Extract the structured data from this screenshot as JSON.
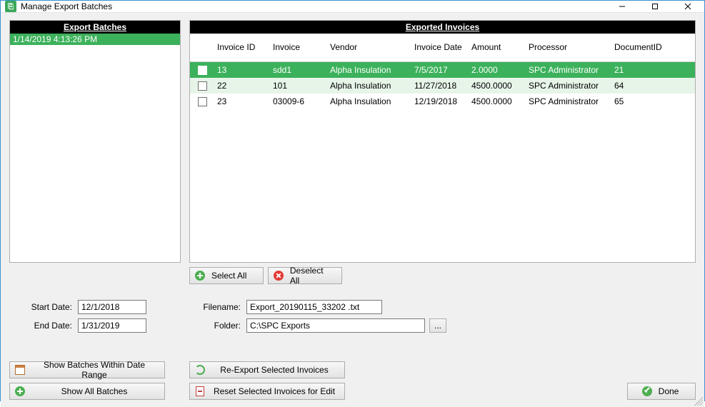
{
  "window": {
    "title": "Manage Export Batches"
  },
  "panels": {
    "batches_header": "Export Batches",
    "invoices_header": "Exported Invoices"
  },
  "batches": [
    {
      "label": "1/14/2019 4:13:26 PM"
    }
  ],
  "invoice_columns": {
    "col1": "Invoice ID",
    "col2": "Invoice",
    "col3": "Vendor",
    "col4": "Invoice Date",
    "col5": "Amount",
    "col6": "Processor",
    "col7": "DocumentID"
  },
  "invoices": [
    {
      "id": "13",
      "invoice": "sdd1",
      "vendor": "Alpha Insulation",
      "date": "7/5/2017",
      "amount": "2.0000",
      "processor": "SPC Administrator",
      "docid": "21"
    },
    {
      "id": "22",
      "invoice": "101",
      "vendor": "Alpha Insulation",
      "date": "11/27/2018",
      "amount": "4500.0000",
      "processor": "SPC Administrator",
      "docid": "64"
    },
    {
      "id": "23",
      "invoice": "03009-6",
      "vendor": "Alpha Insulation",
      "date": "12/19/2018",
      "amount": "4500.0000",
      "processor": "SPC Administrator",
      "docid": "65"
    }
  ],
  "buttons": {
    "select_all": "Select All",
    "deselect_all": "Deselect All",
    "show_range": "Show Batches Within Date Range",
    "show_all": "Show All Batches",
    "reexport": "Re-Export Selected Invoices",
    "reset": "Reset Selected Invoices for Edit",
    "done": "Done",
    "browse": "..."
  },
  "form": {
    "start_date_label": "Start Date:",
    "end_date_label": "End Date:",
    "filename_label": "Filename:",
    "folder_label": "Folder:",
    "start_date": "12/1/2018",
    "end_date": "1/31/2019",
    "filename": "Export_20190115_33202 .txt",
    "folder": "C:\\SPC Exports"
  }
}
